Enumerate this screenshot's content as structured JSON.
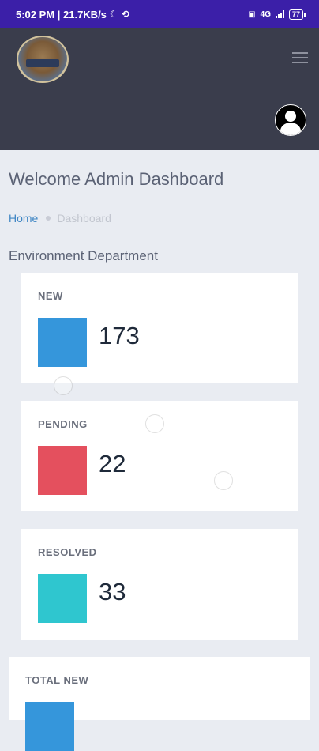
{
  "status_bar": {
    "time": "5:02 PM | 21.7KB/s",
    "icons": [
      "moon-icon",
      "sync-off-icon",
      "sim-icon",
      "signal-icon"
    ],
    "net_label": "4G",
    "battery": "77"
  },
  "header": {
    "logo": "emblem-logo",
    "menu_icon": "hamburger-icon",
    "avatar_icon": "user-avatar-icon"
  },
  "page": {
    "title": "Welcome Admin Dashboard",
    "breadcrumb": {
      "home": "Home",
      "current": "Dashboard"
    },
    "department": "Environment Department"
  },
  "cards": [
    {
      "label": "NEW",
      "value": "173",
      "color": "#3596db"
    },
    {
      "label": "PENDING",
      "value": "22",
      "color": "#e4505e"
    },
    {
      "label": "RESOLVED",
      "value": "33",
      "color": "#2fc6cf"
    },
    {
      "label": "TOTAL NEW",
      "value": "",
      "color": "#3596db"
    }
  ]
}
